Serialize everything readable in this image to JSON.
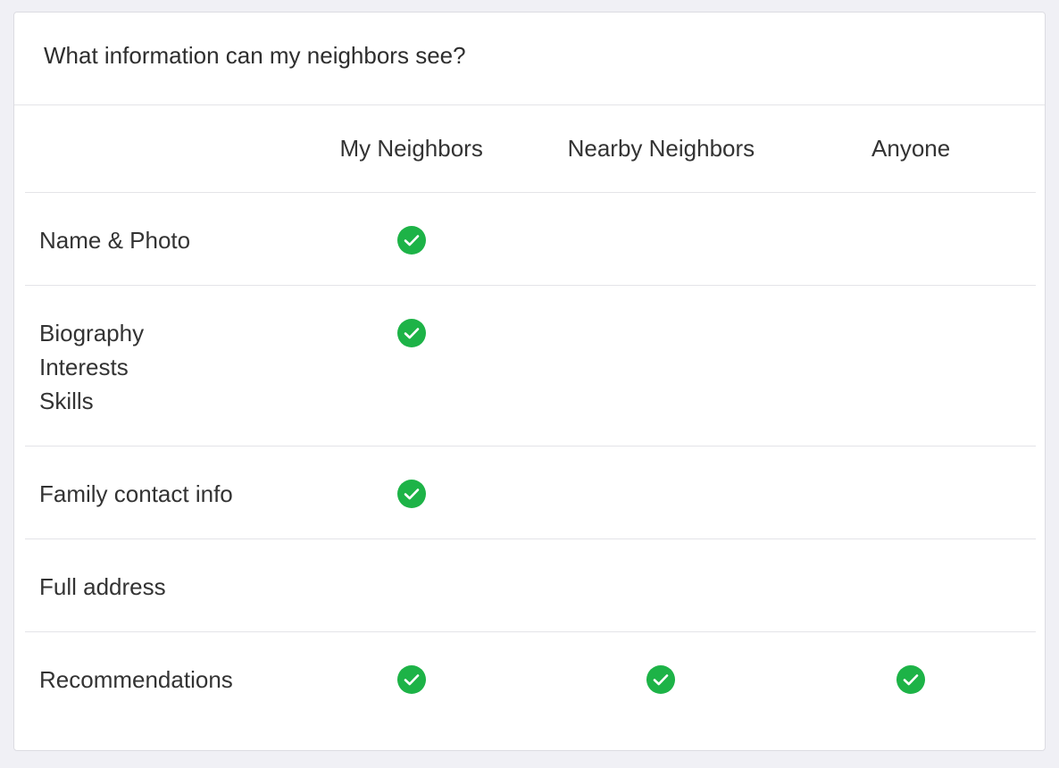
{
  "title": "What information can my neighbors see?",
  "columns": [
    "My Neighbors",
    "Nearby Neighbors",
    "Anyone"
  ],
  "rows": [
    {
      "lines": [
        "Name & Photo"
      ],
      "visible_to": [
        true,
        false,
        false
      ]
    },
    {
      "lines": [
        "Biography",
        "Interests",
        "Skills"
      ],
      "visible_to": [
        true,
        false,
        false
      ]
    },
    {
      "lines": [
        "Family contact info"
      ],
      "visible_to": [
        true,
        false,
        false
      ]
    },
    {
      "lines": [
        "Full address"
      ],
      "visible_to": [
        false,
        false,
        false
      ]
    },
    {
      "lines": [
        "Recommendations"
      ],
      "visible_to": [
        true,
        true,
        true
      ]
    }
  ],
  "colors": {
    "check": "#1db347",
    "divider": "#e4e4e8",
    "text": "#333333"
  },
  "icons": {
    "check": "check-circle-icon"
  }
}
